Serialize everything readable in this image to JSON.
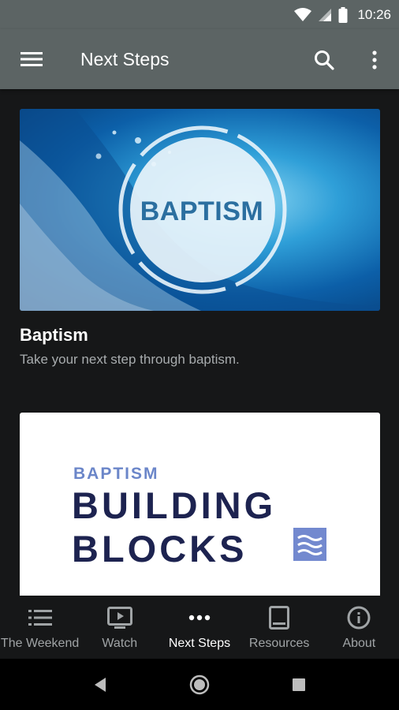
{
  "status_bar": {
    "time": "10:26"
  },
  "app_bar": {
    "title": "Next Steps",
    "menu_icon": "hamburger-menu-icon",
    "search_icon": "search-icon",
    "more_icon": "more-vert-icon"
  },
  "cards": [
    {
      "image_text": "BAPTISM",
      "title": "Baptism",
      "subtitle": "Take your next step through baptism."
    },
    {
      "kicker": "BAPTISM",
      "line1": "BUILDING",
      "line2": "BLOCKS"
    }
  ],
  "bottom_nav": {
    "items": [
      {
        "label": "The Weekend",
        "icon": "list-icon"
      },
      {
        "label": "Watch",
        "icon": "video-play-icon"
      },
      {
        "label": "Next Steps",
        "icon": "more-horiz-icon",
        "active": true
      },
      {
        "label": "Resources",
        "icon": "book-icon"
      },
      {
        "label": "About",
        "icon": "info-icon"
      }
    ]
  },
  "colors": {
    "app_bar": "#5c6464",
    "background": "#161718",
    "brand_navy": "#1d2350",
    "brand_blue": "#6b86c9"
  }
}
